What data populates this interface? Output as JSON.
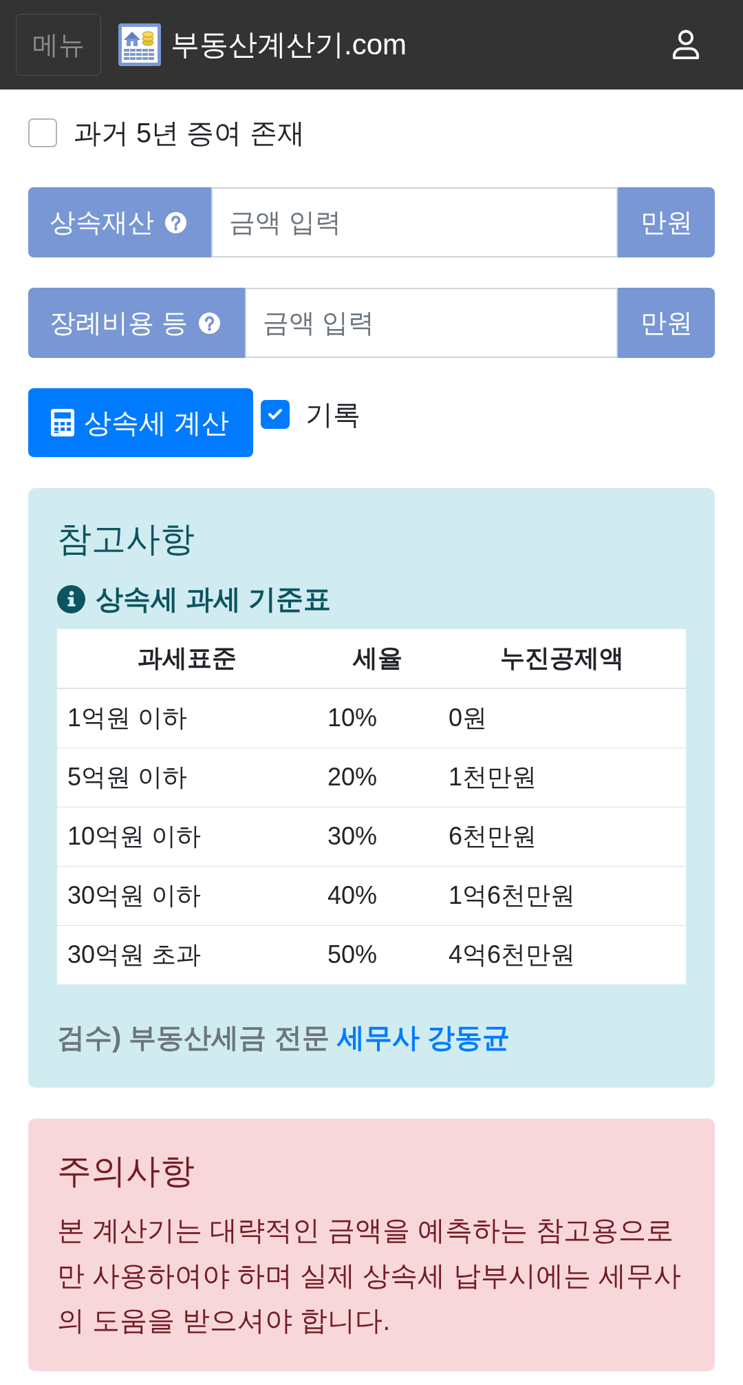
{
  "header": {
    "menu_button": "메뉴",
    "site_title": "부동산계산기.com"
  },
  "gift_option": {
    "label": "과거 5년 증여 존재",
    "checked": false
  },
  "inputs": [
    {
      "label": "상속재산",
      "placeholder": "금액 입력",
      "unit": "만원"
    },
    {
      "label": "장례비용 등",
      "placeholder": "금액 입력",
      "unit": "만원"
    }
  ],
  "calculate_button": "상속세 계산",
  "record_option": {
    "label": "기록",
    "checked": true
  },
  "reference": {
    "title": "참고사항",
    "table_title": "상속세 과세 기준표",
    "table": {
      "columns": [
        "과세표준",
        "세율",
        "누진공제액"
      ],
      "rows": [
        [
          "1억원 이하",
          "10%",
          "0원"
        ],
        [
          "5억원 이하",
          "20%",
          "1천만원"
        ],
        [
          "10억원 이하",
          "30%",
          "6천만원"
        ],
        [
          "30억원 이하",
          "40%",
          "1억6천만원"
        ],
        [
          "30억원 초과",
          "50%",
          "4억6천만원"
        ]
      ]
    },
    "review": {
      "text": "검수) 부동산세금 전문",
      "link": "세무사 강동균"
    }
  },
  "caution": {
    "title": "주의사항",
    "text": "본 계산기는 대략적인 금액을 예측하는 참고용으로만 사용하여야 하며 실제 상속세 납부시에는 세무사의 도움을 받으셔야 합니다."
  }
}
